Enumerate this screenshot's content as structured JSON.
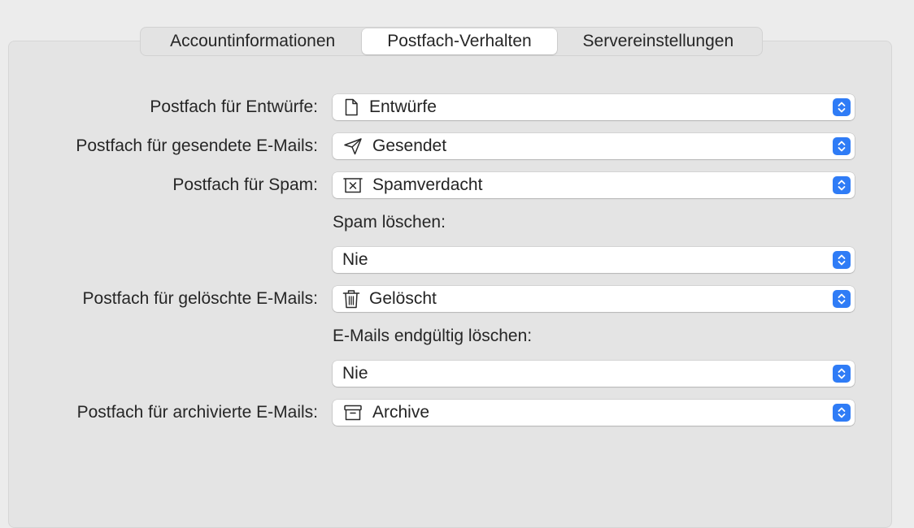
{
  "tabs": {
    "account": "Accountinformationen",
    "mailbox_behavior": "Postfach-Verhalten",
    "server": "Servereinstellungen",
    "selected": "Postfach-Verhalten"
  },
  "rows": {
    "drafts": {
      "label": "Postfach für Entwürfe:",
      "value": "Entwürfe",
      "icon": "document-icon"
    },
    "sent": {
      "label": "Postfach für gesendete E-Mails:",
      "value": "Gesendet",
      "icon": "paper-plane-icon"
    },
    "spam": {
      "label": "Postfach für Spam:",
      "value": "Spamverdacht",
      "icon": "junk-box-icon"
    },
    "spam_delete": {
      "label": "Spam löschen:",
      "value": "Nie"
    },
    "trash": {
      "label": "Postfach für gelöschte E-Mails:",
      "value": "Gelöscht",
      "icon": "trash-icon"
    },
    "trash_delete": {
      "label": "E-Mails endgültig löschen:",
      "value": "Nie"
    },
    "archive": {
      "label": "Postfach für archivierte E-Mails:",
      "value": "Archive",
      "icon": "archive-box-icon"
    }
  },
  "colors": {
    "accent": "#2f7cf6",
    "window_bg": "#ececec",
    "panel_bg": "#e4e4e4"
  }
}
